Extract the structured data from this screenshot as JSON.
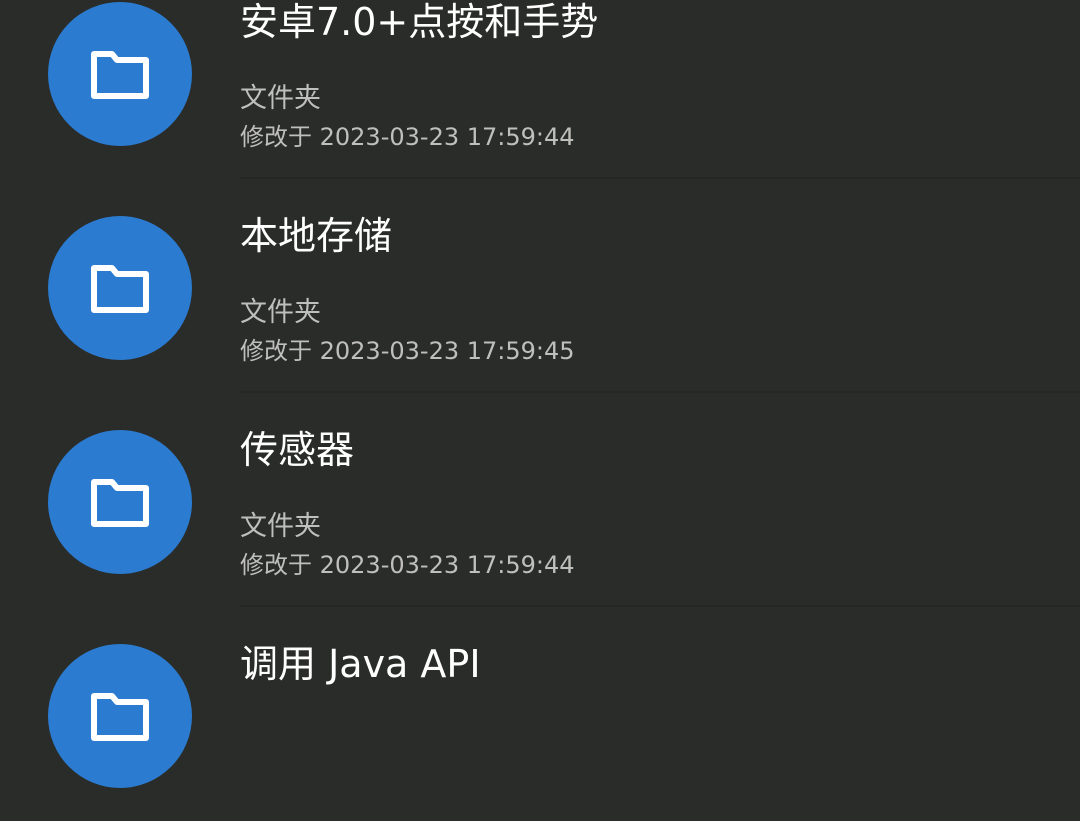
{
  "colors": {
    "background": "#2a2c29",
    "icon_circle": "#2b7bd0",
    "title_text": "#ffffff",
    "secondary_text": "#bfbfbc"
  },
  "items": [
    {
      "icon": "folder-icon",
      "title": "安卓7.0+点按和手势",
      "type": "文件夹",
      "modified": "修改于 2023-03-23 17:59:44"
    },
    {
      "icon": "folder-icon",
      "title": "本地存储",
      "type": "文件夹",
      "modified": "修改于 2023-03-23 17:59:45"
    },
    {
      "icon": "folder-icon",
      "title": "传感器",
      "type": "文件夹",
      "modified": "修改于 2023-03-23 17:59:44"
    },
    {
      "icon": "folder-icon",
      "title": "调用 Java API",
      "type": "",
      "modified": ""
    }
  ]
}
